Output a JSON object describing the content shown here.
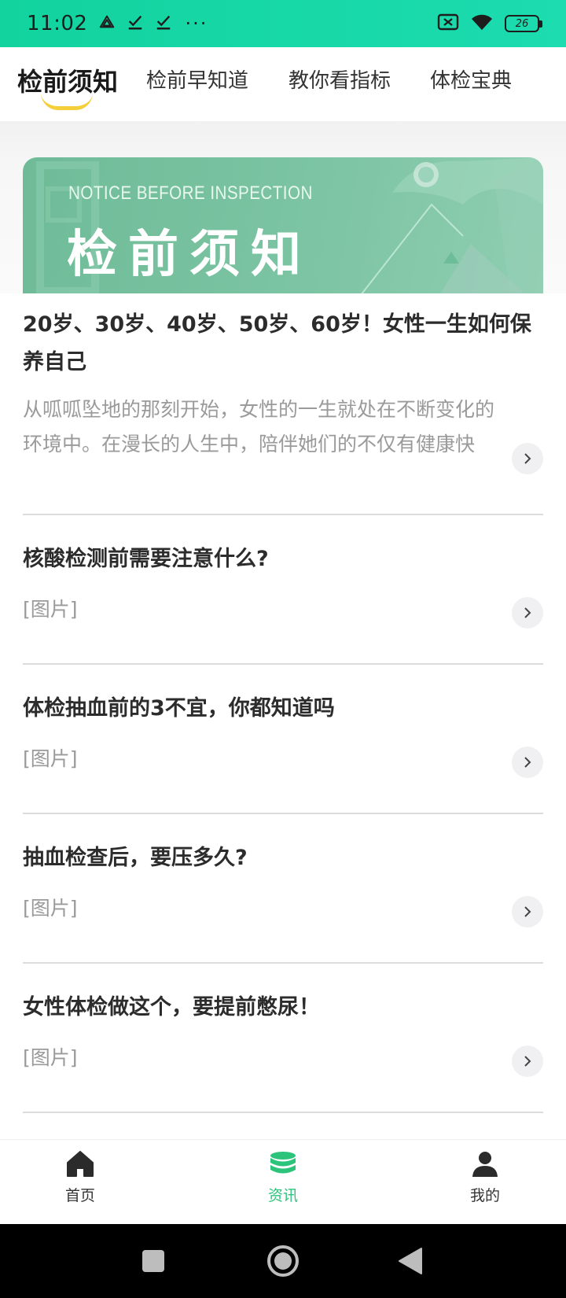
{
  "status_bar": {
    "time": "11:02",
    "more": "···",
    "battery": "26",
    "icons": [
      "drive-icon",
      "check-icon",
      "check-icon",
      "sim-off-icon",
      "wifi-icon",
      "battery-icon"
    ]
  },
  "tabs": [
    {
      "label": "检前须知",
      "active": true
    },
    {
      "label": "检前早知道",
      "active": false
    },
    {
      "label": "教你看指标",
      "active": false
    },
    {
      "label": "体检宝典",
      "active": false
    }
  ],
  "banner": {
    "subtitle": "NOTICE BEFORE INSPECTION",
    "title": "检前须知"
  },
  "articles": [
    {
      "title": "20岁、30岁、40岁、50岁、60岁！女性一生如何保养自己",
      "summary": "从呱呱坠地的那刻开始，女性的一生就处在不断变化的环境中。在漫长的人生中，陪伴她们的不仅有健康快"
    },
    {
      "title": "核酸检测前需要注意什么?",
      "summary": "[图片]"
    },
    {
      "title": "体检抽血前的3不宜，你都知道吗",
      "summary": "[图片]"
    },
    {
      "title": "抽血检查后，要压多久?",
      "summary": "[图片]"
    },
    {
      "title": "女性体检做这个，要提前憋尿！",
      "summary": "[图片]"
    }
  ],
  "bottom_nav": [
    {
      "label": "首页",
      "icon": "home-icon",
      "active": false
    },
    {
      "label": "资讯",
      "icon": "database-icon",
      "active": true
    },
    {
      "label": "我的",
      "icon": "user-icon",
      "active": false
    }
  ],
  "colors": {
    "status_bar": "#12d39e",
    "accent": "#2cc37b",
    "tab_underline": "#f4cf3a",
    "banner": "#7cc4a3"
  }
}
